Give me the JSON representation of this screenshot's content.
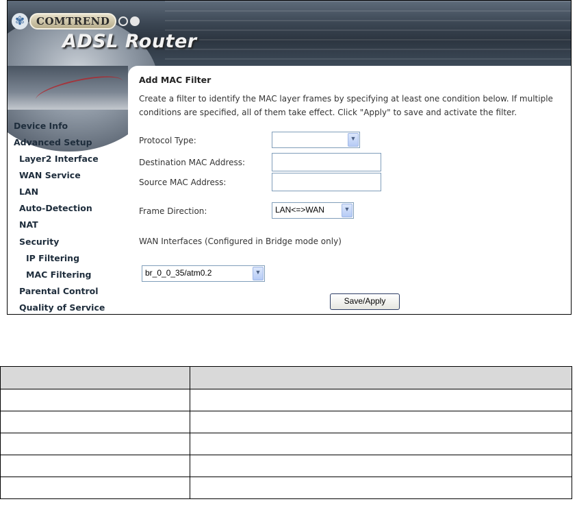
{
  "header": {
    "brand": "COMTREND",
    "product": "ADSL Router"
  },
  "sidebar": {
    "items": [
      {
        "label": "Device Info",
        "level": 0
      },
      {
        "label": "Advanced Setup",
        "level": 0
      },
      {
        "label": "Layer2 Interface",
        "level": 1
      },
      {
        "label": "WAN Service",
        "level": 1
      },
      {
        "label": "LAN",
        "level": 1
      },
      {
        "label": "Auto-Detection",
        "level": 1
      },
      {
        "label": "NAT",
        "level": 1
      },
      {
        "label": "Security",
        "level": 1
      },
      {
        "label": "IP Filtering",
        "level": 2
      },
      {
        "label": "MAC Filtering",
        "level": 2
      },
      {
        "label": "Parental Control",
        "level": 1
      },
      {
        "label": "Quality of Service",
        "level": 1
      }
    ]
  },
  "main": {
    "title": "Add MAC Filter",
    "description": "Create a filter to identify the MAC layer frames by specifying at least one condition below. If multiple conditions are specified, all of them take effect. Click \"Apply\" to save and activate the filter.",
    "protocol_type_label": "Protocol Type:",
    "protocol_type_value": "",
    "dest_mac_label": "Destination MAC Address:",
    "dest_mac_value": "",
    "src_mac_label": "Source MAC Address:",
    "src_mac_value": "",
    "frame_direction_label": "Frame Direction:",
    "frame_direction_value": "LAN<=>WAN",
    "wan_interfaces_label": "WAN Interfaces (Configured in Bridge mode only)",
    "wan_interface_value": "br_0_0_35/atm0.2",
    "save_apply_label": "Save/Apply"
  },
  "table": {
    "rows": 5
  },
  "colors": {
    "header_dark": "#2c3540",
    "nav_text": "#1e2d3c",
    "input_border": "#7f9db9",
    "button_border": "#2b3b63",
    "table_header_bg": "#d9d9d9"
  }
}
